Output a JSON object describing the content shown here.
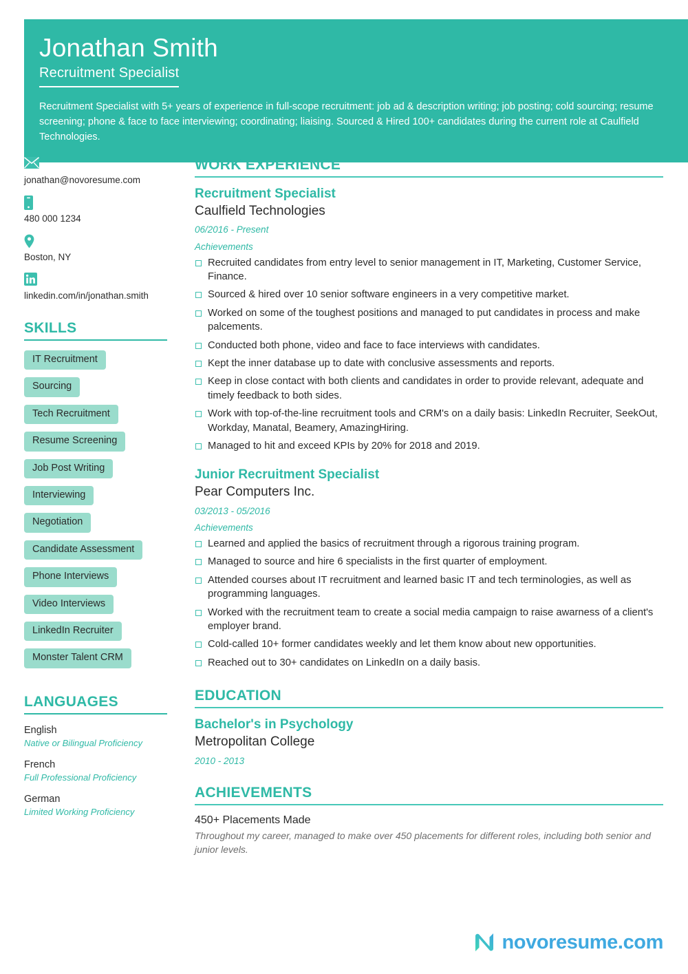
{
  "header": {
    "name": "Jonathan Smith",
    "title": "Recruitment Specialist",
    "summary": "Recruitment Specialist with 5+ years of experience in full-scope recruitment: job ad & description writing; job posting; cold sourcing; resume screening; phone & face to face interviewing; coordinating; liaising. Sourced & Hired 100+ candidates during the current role at Caulfield Technologies.",
    "accent_color": "#2FB9A6"
  },
  "contact": {
    "email": "jonathan@novoresume.com",
    "phone": "480 000 1234",
    "location": "Boston, NY",
    "linkedin": "linkedin.com/in/jonathan.smith",
    "icons": {
      "email": "envelope-icon",
      "phone": "mobile-phone-icon",
      "location": "map-pin-icon",
      "linkedin": "linkedin-icon"
    }
  },
  "skills": {
    "heading": "SKILLS",
    "items": [
      "IT Recruitment",
      "Sourcing",
      "Tech Recruitment",
      "Resume Screening",
      "Job Post Writing",
      "Interviewing",
      "Negotiation",
      "Candidate Assessment",
      "Phone Interviews",
      "Video Interviews",
      "LinkedIn Recruiter",
      "Monster Talent CRM"
    ],
    "pill_color": "#9ADCCC"
  },
  "languages": {
    "heading": "LANGUAGES",
    "items": [
      {
        "name": "English",
        "level": "Native or Bilingual Proficiency"
      },
      {
        "name": "French",
        "level": "Full Professional Proficiency"
      },
      {
        "name": "German",
        "level": "Limited Working Proficiency"
      }
    ]
  },
  "work_experience": {
    "heading": "WORK EXPERIENCE",
    "jobs": [
      {
        "title": "Recruitment Specialist",
        "company": "Caulfield Technologies",
        "dates": "06/2016 - Present",
        "sublabel": "Achievements",
        "bullets": [
          "Recruited candidates from entry level to senior management in IT, Marketing, Customer Service, Finance.",
          "Sourced & hired over 10 senior software engineers in a very competitive market.",
          "Worked on some of the toughest positions and managed to put candidates in process and make palcements.",
          "Conducted both phone, video and face to face interviews with candidates.",
          "Kept the inner database up to date with conclusive assessments and reports.",
          "Keep in close contact with both clients and candidates in order to provide relevant, adequate and timely feedback to both sides.",
          "Work with top-of-the-line recruitment tools and CRM's on a daily basis: LinkedIn Recruiter, SeekOut, Workday, Manatal, Beamery, AmazingHiring.",
          "Managed to hit and exceed KPIs by 20% for 2018 and 2019."
        ]
      },
      {
        "title": "Junior Recruitment Specialist",
        "company": "Pear Computers Inc.",
        "dates": "03/2013 - 05/2016",
        "sublabel": "Achievements",
        "bullets": [
          "Learned and applied the basics of recruitment through a rigorous training program.",
          "Managed to source and hire 6 specialists in the first quarter of employment.",
          "Attended courses about IT recruitment and learned basic IT and tech terminologies, as well as programming languages.",
          "Worked with the recruitment team to create a social media campaign to raise awarness of a client's employer brand.",
          "Cold-called 10+ former candidates weekly and let them know about new opportunities.",
          "Reached out to 30+ candidates on LinkedIn on a daily basis."
        ]
      }
    ]
  },
  "education": {
    "heading": "EDUCATION",
    "items": [
      {
        "degree": "Bachelor's in Psychology",
        "school": "Metropolitan College",
        "dates": "2010 - 2013"
      }
    ]
  },
  "achievements": {
    "heading": "ACHIEVEMENTS",
    "items": [
      {
        "title": "450+ Placements Made",
        "description": "Throughout my career, managed to make over 450 placements for different roles, including both senior and junior levels."
      }
    ]
  },
  "footer": {
    "brand": "novoresume.com",
    "logo_icon": "novoresume-n-logo-icon",
    "brand_color": "#3FA9E0"
  }
}
